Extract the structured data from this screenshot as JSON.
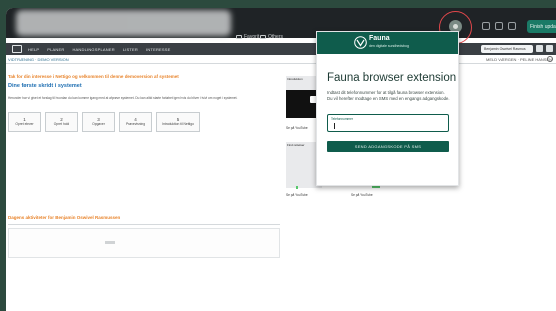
{
  "browser": {
    "bookmarks": [
      "Favorit",
      "Others"
    ],
    "update_button": "Finish update"
  },
  "app_nav": {
    "items": [
      "HELP",
      "PLANER",
      "HANDLINGSPLANER",
      "LISTER",
      "INTERESSE"
    ],
    "user_label": "Benjamin Oswivel Rasmus"
  },
  "breadcrumb": {
    "left": "VIDTRÆNING · DEMO VERSION",
    "right": "MELD VÆRGEN · PELINE HANSEN"
  },
  "page": {
    "welcome": "Tak for din interesse i Nettigo og velkommen til denne demoversion af systemet",
    "steps_heading": "Dine første skridt i systemet",
    "body_text": "Herunder har vi givet et forslag til hvordan du kan komme igang med at afprøve systemet. Du kan altid starte forløbet igen hvis du bliver i tvivl om noget i systemet.",
    "steps": [
      {
        "num": "1",
        "label": "Opret elever"
      },
      {
        "num": "2",
        "label": "Opret hold"
      },
      {
        "num": "3",
        "label": "Opgaver"
      },
      {
        "num": "4",
        "label": "Prøvevisning"
      },
      {
        "num": "5",
        "label": "Introduktion til Nettigo"
      }
    ],
    "activities_heading": "Dagens aktiviteter for Benjamin Oswivel Rasmussen"
  },
  "videos": [
    {
      "title": "Introduktion",
      "caption": "Se på YouTube"
    },
    {
      "title": "Find rettelser",
      "caption": "Se på YouTube"
    }
  ],
  "popup": {
    "brand": "Fauna",
    "brand_sub": "den digitale sundhedsbog",
    "title": "Fauna browser extension",
    "description": "Indtast dit telefonnummer for at tilgå fauna browser extension. Du vil herefter modtage en SMS med en engangs adgangskode.",
    "field_label": "Telefonnummer",
    "field_value": "",
    "send_button": "SEND ADGANGSKODE PÅ SMS"
  }
}
